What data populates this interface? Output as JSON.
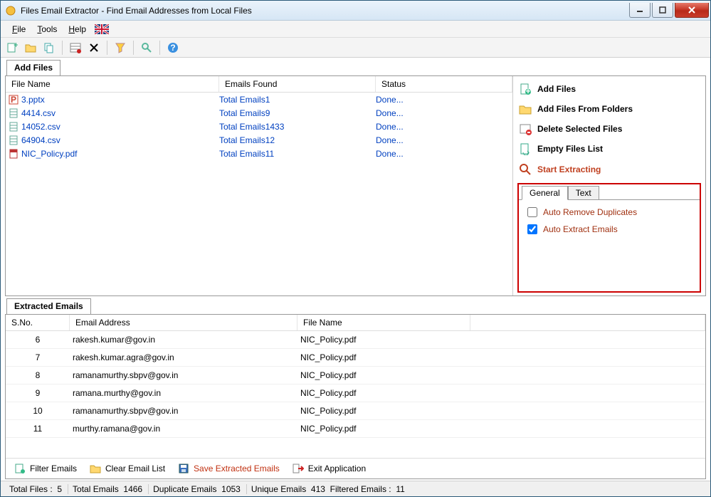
{
  "title": "Files Email Extractor -   Find Email Addresses from Local Files",
  "menu": {
    "file": "File",
    "tools": "Tools",
    "help": "Help"
  },
  "tabs": {
    "addfiles": "Add Files",
    "extracted": "Extracted Emails"
  },
  "file_headers": {
    "name": "File Name",
    "emails": "Emails Found",
    "status": "Status"
  },
  "files": [
    {
      "icon": "ppt",
      "name": "3.pptx",
      "emails": "Total Emails1",
      "status": "Done..."
    },
    {
      "icon": "csv",
      "name": "4414.csv",
      "emails": "Total Emails9",
      "status": "Done..."
    },
    {
      "icon": "csv",
      "name": "14052.csv",
      "emails": "Total Emails1433",
      "status": "Done..."
    },
    {
      "icon": "csv",
      "name": "64904.csv",
      "emails": "Total Emails12",
      "status": "Done..."
    },
    {
      "icon": "pdf",
      "name": "NIC_Policy.pdf",
      "emails": "Total Emails11",
      "status": "Done..."
    }
  ],
  "side": {
    "add_files": "Add Files",
    "add_from_folders": "Add Files From Folders",
    "delete_selected": "Delete Selected Files",
    "empty_list": "Empty Files List",
    "start_extracting": "Start Extracting"
  },
  "opt_tabs": {
    "general": "General",
    "text": "Text"
  },
  "options": {
    "auto_remove_dup": "Auto Remove Duplicates",
    "auto_extract": "Auto Extract Emails"
  },
  "email_headers": {
    "sno": "S.No.",
    "email": "Email Address",
    "file": "File Name"
  },
  "emails": [
    {
      "sno": "6",
      "email": "rakesh.kumar@gov.in",
      "file": "NIC_Policy.pdf"
    },
    {
      "sno": "7",
      "email": "rakesh.kumar.agra@gov.in",
      "file": "NIC_Policy.pdf"
    },
    {
      "sno": "8",
      "email": "ramanamurthy.sbpv@gov.in",
      "file": "NIC_Policy.pdf"
    },
    {
      "sno": "9",
      "email": "ramana.murthy@gov.in",
      "file": "NIC_Policy.pdf"
    },
    {
      "sno": "10",
      "email": "ramanamurthy.sbpv@gov.in",
      "file": "NIC_Policy.pdf"
    },
    {
      "sno": "11",
      "email": "murthy.ramana@gov.in",
      "file": "NIC_Policy.pdf"
    }
  ],
  "actions": {
    "filter": "Filter Emails",
    "clear": "Clear Email List",
    "save": "Save Extracted Emails",
    "exit": "Exit Application"
  },
  "status": {
    "total_files_lbl": "Total Files :",
    "total_files_val": "5",
    "total_emails_lbl": "Total Emails",
    "total_emails_val": "1466",
    "dup_lbl": "Duplicate Emails",
    "dup_val": "1053",
    "unique_lbl": "Unique Emails",
    "unique_val": "413",
    "filtered_lbl": "Filtered Emails :",
    "filtered_val": "11"
  }
}
